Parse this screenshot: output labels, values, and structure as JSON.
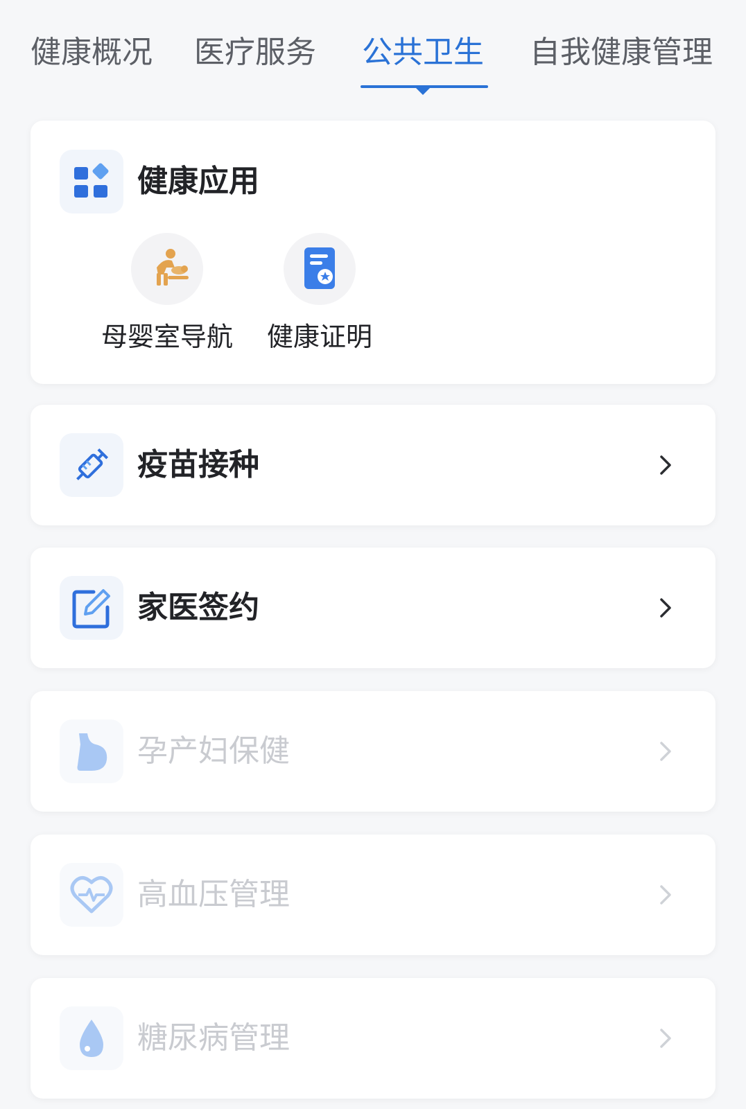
{
  "tabs": [
    {
      "label": "健康概况"
    },
    {
      "label": "医疗服务"
    },
    {
      "label": "公共卫生",
      "active": true
    },
    {
      "label": "自我健康管理"
    }
  ],
  "health_apps": {
    "title": "健康应用",
    "icon": "grid-apps-icon",
    "apps": [
      {
        "label": "母婴室导航",
        "icon": "mother-baby-icon"
      },
      {
        "label": "健康证明",
        "icon": "health-certificate-icon"
      }
    ]
  },
  "services": [
    {
      "title": "疫苗接种",
      "icon": "syringe-icon",
      "enabled": true
    },
    {
      "title": "家医签约",
      "icon": "edit-sign-icon",
      "enabled": true
    },
    {
      "title": "孕产妇保健",
      "icon": "pregnancy-icon",
      "enabled": false
    },
    {
      "title": "高血压管理",
      "icon": "heart-pulse-icon",
      "enabled": false
    },
    {
      "title": "糖尿病管理",
      "icon": "blood-drop-icon",
      "enabled": false
    }
  ],
  "colors": {
    "accent": "#2a72d6",
    "disabled_text": "#c9cbd0",
    "mother_baby_icon": "#e3a34f"
  }
}
